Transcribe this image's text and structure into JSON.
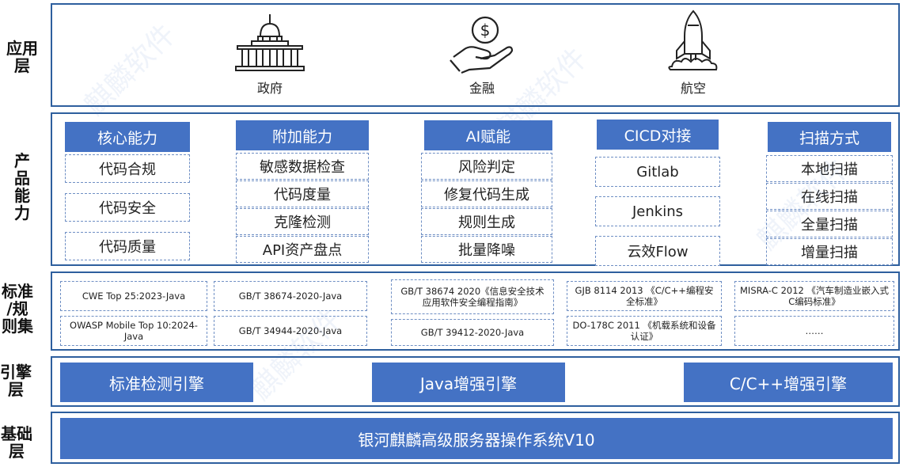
{
  "layers": {
    "application": "应用\n层",
    "capability": "产\n品\n能\n力",
    "standards": "标准\n/规\n则集",
    "engine": "引擎\n层",
    "base": "基础\n层"
  },
  "application": {
    "items": [
      {
        "label": "政府",
        "icon": "government-building-icon"
      },
      {
        "label": "金融",
        "icon": "hand-dollar-coin-icon"
      },
      {
        "label": "航空",
        "icon": "rocket-icon"
      }
    ]
  },
  "capability": {
    "groups": [
      {
        "title": "核心能力",
        "items": [
          "代码合规",
          "代码安全",
          "代码质量"
        ]
      },
      {
        "title": "附加能力",
        "items": [
          "敏感数据检查",
          "代码度量",
          "克隆检测",
          "API资产盘点"
        ]
      },
      {
        "title": "AI赋能",
        "items": [
          "风险判定",
          "修复代码生成",
          "规则生成",
          "批量降噪"
        ]
      },
      {
        "title": "CICD对接",
        "items": [
          "Gitlab",
          "Jenkins",
          "云效Flow"
        ]
      },
      {
        "title": "扫描方式",
        "items": [
          "本地扫描",
          "在线扫描",
          "全量扫描",
          "增量扫描"
        ]
      }
    ]
  },
  "standards": {
    "items": [
      "CWE Top 25:2023-Java",
      "OWASP Mobile Top 10:2024-Java",
      "GB/T 38674-2020-Java",
      "GB/T 34944-2020-Java",
      "GB/T 38674  2020《信息安全技术应用软件安全编程指南》",
      "GB/T 39412-2020-Java",
      "GJB 8114   2013 《C/C++编程安全标准》",
      "DO-178C   2011 《机载系统和设备认证》",
      "MISRA-C   2012 《汽车制造业嵌入式C编码标准》",
      "……"
    ]
  },
  "engines": [
    "标准检测引擎",
    "Java增强引擎",
    "C/C++增强引擎"
  ],
  "base": {
    "os": "银河麒麟高级服务器操作系统V10"
  },
  "watermark": "麒麟软件",
  "colors": {
    "accent": "#4472c4",
    "border": "#2e5f9e",
    "dash": "#6f8fc4"
  }
}
